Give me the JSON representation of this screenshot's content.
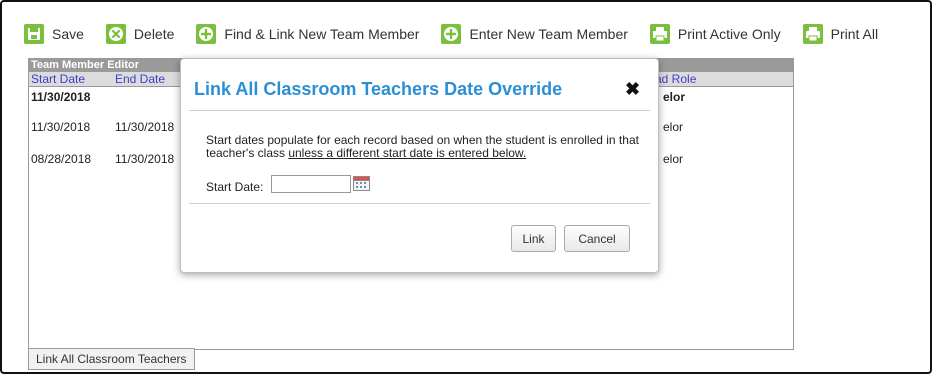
{
  "toolbar": {
    "save": {
      "label": "Save",
      "icon": "save-icon"
    },
    "delete": {
      "label": "Delete",
      "icon": "delete-icon"
    },
    "find_link": {
      "label": "Find & Link New Team Member",
      "icon": "plus-icon"
    },
    "enter_new": {
      "label": "Enter New Team Member",
      "icon": "plus-icon"
    },
    "print_active": {
      "label": "Print Active Only",
      "icon": "printer-icon"
    },
    "print_all": {
      "label": "Print All",
      "icon": "printer-icon"
    },
    "icon_color": "#7bbf3e"
  },
  "panel": {
    "title": "Team Member Editor",
    "columns": [
      "Start Date",
      "End Date",
      "ad Role"
    ],
    "rows": [
      {
        "start": "11/30/2018",
        "end": "",
        "role": "elor"
      },
      {
        "start": "11/30/2018",
        "end": "11/30/2018",
        "role": "elor"
      },
      {
        "start": "08/28/2018",
        "end": "11/30/2018",
        "role": "elor"
      }
    ]
  },
  "link_all_button": "Link All Classroom Teachers",
  "modal": {
    "title": "Link All Classroom Teachers Date Override",
    "close_glyph": "✖",
    "description": "Start dates populate for each record based on when the student is enrolled in that teacher's class ",
    "description_underlined": "unless a different start date is entered below.",
    "start_date_label": "Start Date:",
    "start_date_value": "",
    "link_label": "Link",
    "cancel_label": "Cancel",
    "title_color": "#2b8fd6"
  }
}
